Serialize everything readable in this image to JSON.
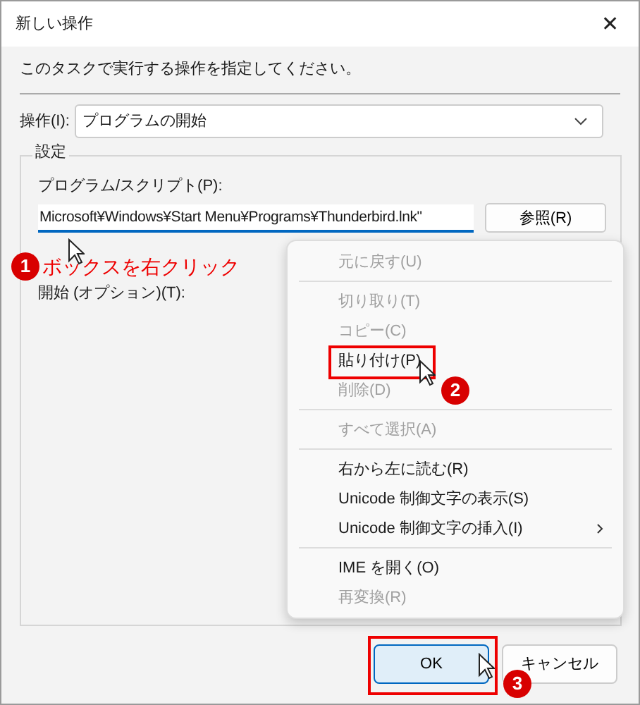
{
  "window": {
    "title": "新しい操作",
    "close": "✕"
  },
  "instruction": "このタスクで実行する操作を指定してください。",
  "action": {
    "label": "操作(I):",
    "value": "プログラムの開始"
  },
  "settings": {
    "title": "設定",
    "program_label": "プログラム/スクリプト(P):",
    "program_value": "Microsoft¥Windows¥Start Menu¥Programs¥Thunderbird.lnk\"",
    "browse": "参照(R)",
    "start_label": "開始 (オプション)(T):"
  },
  "context_menu": [
    {
      "kind": "item",
      "label": "元に戻す(U)",
      "disabled": true
    },
    {
      "kind": "separator"
    },
    {
      "kind": "item",
      "label": "切り取り(T)",
      "disabled": true
    },
    {
      "kind": "item",
      "label": "コピー(C)",
      "disabled": true
    },
    {
      "kind": "item",
      "label": "貼り付け(P)",
      "disabled": false
    },
    {
      "kind": "item",
      "label": "削除(D)",
      "disabled": true
    },
    {
      "kind": "separator"
    },
    {
      "kind": "item",
      "label": "すべて選択(A)",
      "disabled": true
    },
    {
      "kind": "separator"
    },
    {
      "kind": "item",
      "label": "右から左に読む(R)",
      "disabled": false
    },
    {
      "kind": "item",
      "label": "Unicode 制御文字の表示(S)",
      "disabled": false
    },
    {
      "kind": "item",
      "label": "Unicode 制御文字の挿入(I)",
      "disabled": false,
      "submenu": true
    },
    {
      "kind": "separator"
    },
    {
      "kind": "item",
      "label": "IME を開く(O)",
      "disabled": false
    },
    {
      "kind": "item",
      "label": "再変換(R)",
      "disabled": true
    }
  ],
  "buttons": [
    {
      "label": "OK",
      "default": true
    },
    {
      "label": "キャンセル",
      "default": false
    }
  ],
  "annotations": [
    {
      "number": "1",
      "text": "ボックスを右クリック"
    },
    {
      "number": "2"
    },
    {
      "number": "3"
    }
  ]
}
